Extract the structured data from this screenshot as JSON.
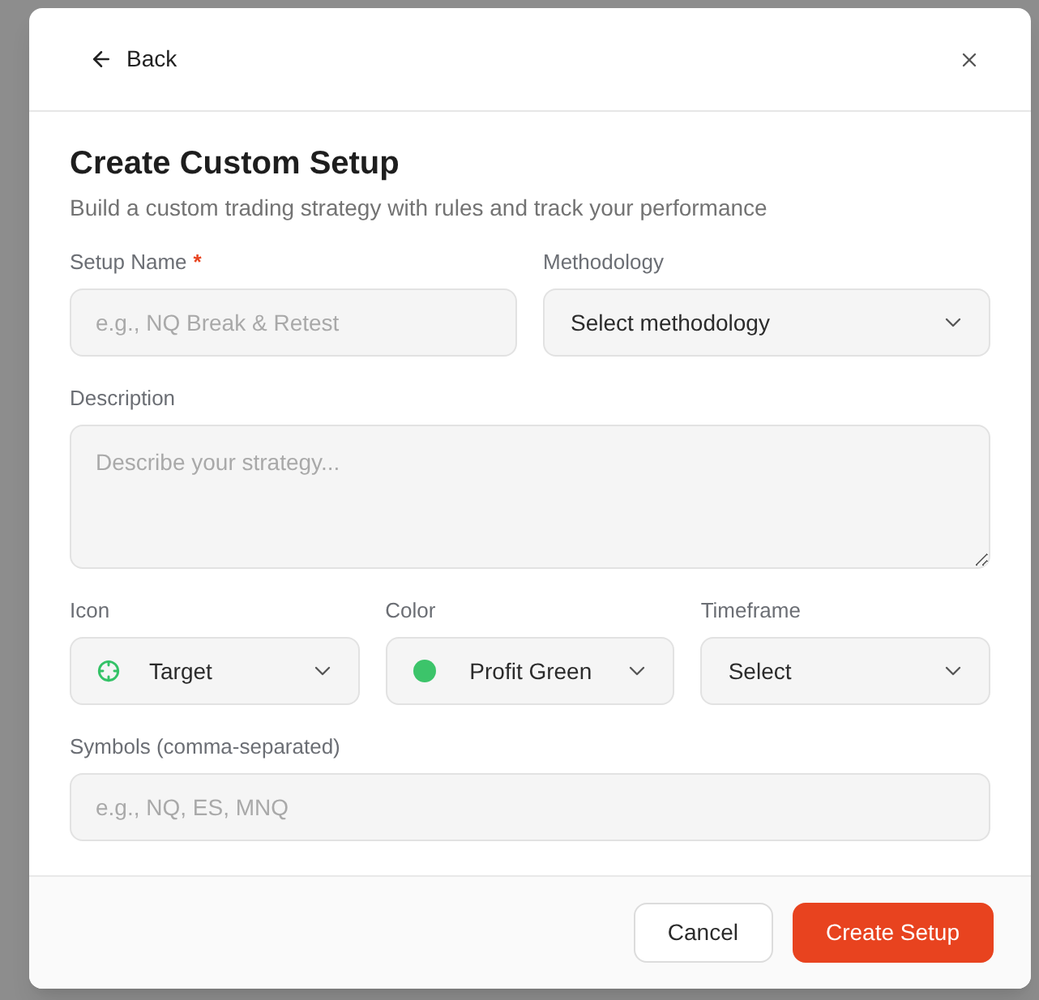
{
  "header": {
    "back_label": "Back"
  },
  "title": "Create Custom Setup",
  "subtitle": "Build a custom trading strategy with rules and track your performance",
  "rows": [
    {
      "fields": [
        {
          "kind": "text",
          "label": "Setup Name",
          "required_mark": "*",
          "placeholder": "e.g., NQ Break & Retest"
        },
        {
          "kind": "select",
          "label": "Methodology",
          "value": "Select methodology"
        }
      ]
    },
    {
      "fields": [
        {
          "kind": "textarea",
          "label": "Description",
          "placeholder": "Describe your strategy..."
        }
      ]
    },
    {
      "fields": [
        {
          "kind": "icon-select",
          "label": "Icon",
          "value": "Target"
        },
        {
          "kind": "color-select",
          "label": "Color",
          "value": "Profit Green",
          "color": "#3cc46a"
        },
        {
          "kind": "select",
          "label": "Timeframe",
          "value": "Select"
        }
      ]
    },
    {
      "fields": [
        {
          "kind": "text",
          "label": "Symbols (comma-separated)",
          "placeholder": "e.g., NQ, ES, MNQ"
        }
      ]
    }
  ],
  "footer": {
    "buttons": [
      {
        "kind": "secondary",
        "label": "Cancel"
      },
      {
        "kind": "primary",
        "label": "Create Setup"
      }
    ]
  }
}
